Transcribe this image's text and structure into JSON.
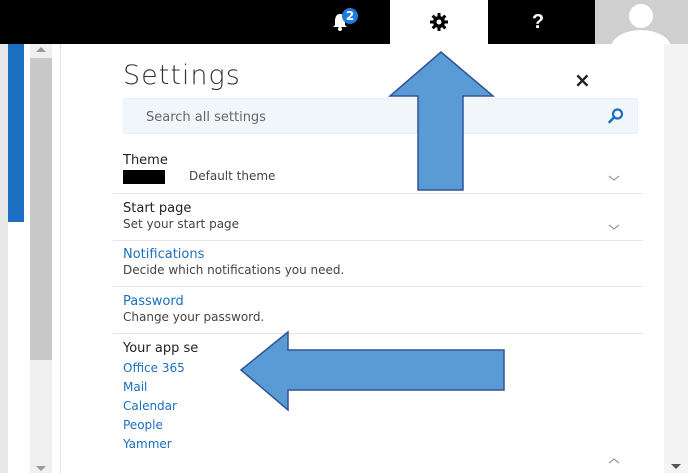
{
  "topbar": {
    "notification_count": "2",
    "help_label": "?",
    "icons": [
      "bell-icon",
      "gear-icon",
      "help-icon",
      "avatar-icon"
    ]
  },
  "settings": {
    "title": "Settings",
    "close_label": "×",
    "search_placeholder": "Search all settings",
    "theme": {
      "title": "Theme",
      "value": "Default theme"
    },
    "start_page": {
      "title": "Start page",
      "subtitle": "Set your start page"
    },
    "notifications": {
      "title": "Notifications",
      "subtitle": "Decide which notifications you need."
    },
    "password": {
      "title": "Password",
      "subtitle": "Change your password."
    },
    "app_settings": {
      "title": "Your app se",
      "items": [
        "Office 365",
        "Mail",
        "Calendar",
        "People",
        "Yammer"
      ]
    }
  },
  "colors": {
    "accent": "#1a6fc0",
    "arrow_fill": "#5b9bd5",
    "arrow_stroke": "#2f5597"
  }
}
